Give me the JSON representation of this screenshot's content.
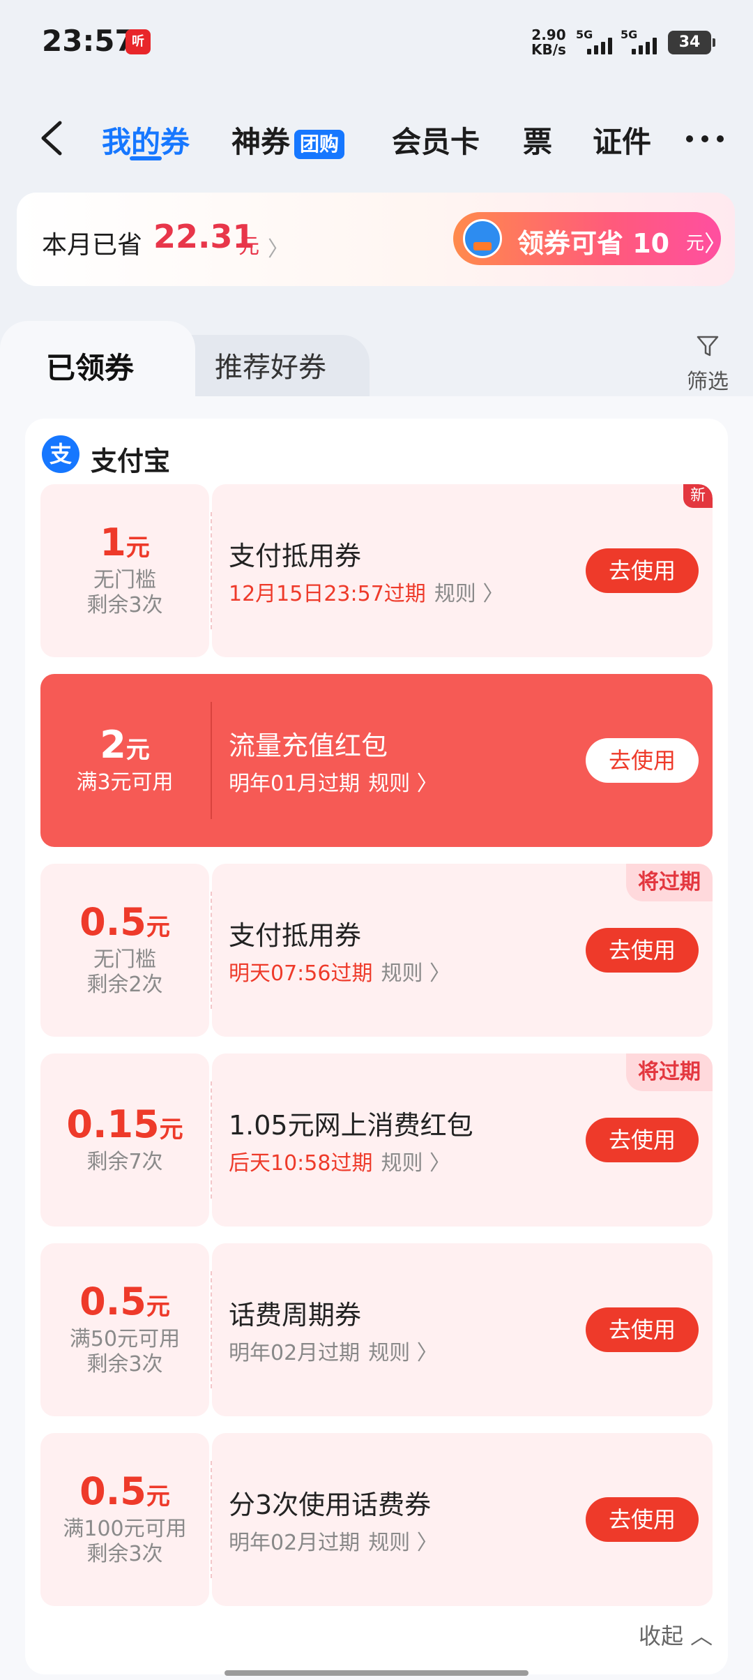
{
  "status_bar": {
    "time": "23:57",
    "app_icon_text": "听",
    "net_speed_value": "2.90",
    "net_speed_unit": "KB/s",
    "sim1_label": "5G",
    "sim2_label": "5G",
    "battery": "34"
  },
  "nav": {
    "tabs": [
      {
        "label": "我的券",
        "active": true
      },
      {
        "label": "神券",
        "badge": "团购"
      },
      {
        "label": "会员卡"
      },
      {
        "label": "票"
      },
      {
        "label": "证件"
      }
    ],
    "more_icon": "more-dots-icon",
    "back_icon": "chevron-left-icon"
  },
  "savings": {
    "label": "本月已省",
    "amount": "22.31",
    "unit": "元",
    "pill_text": "领券可省 10",
    "pill_unit": "元"
  },
  "list_tabs": {
    "claimed": "已领券",
    "recommended": "推荐好券",
    "filter": "筛选"
  },
  "provider": {
    "logo_text": "支",
    "name": "支付宝"
  },
  "coupons": [
    {
      "amount": "1",
      "unit": "元",
      "cond1": "无门槛",
      "cond2": "剩余3次",
      "title": "支付抵用券",
      "expiry": "12月15日23:57过期",
      "rules": "规则 〉",
      "button": "去使用",
      "tag": "新"
    },
    {
      "amount": "2",
      "unit": "元",
      "cond1": "满3元可用",
      "cond2": "",
      "title": "流量充值红包",
      "expiry": "明年01月过期",
      "rules": "规则 〉",
      "button": "去使用",
      "tag": ""
    },
    {
      "amount": "0.5",
      "unit": "元",
      "cond1": "无门槛",
      "cond2": "剩余2次",
      "title": "支付抵用券",
      "expiry": "明天07:56过期",
      "rules": "规则 〉",
      "button": "去使用",
      "tag": "将过期"
    },
    {
      "amount": "0.15",
      "unit": "元",
      "cond1": "剩余7次",
      "cond2": "",
      "title": "1.05元网上消费红包",
      "expiry": "后天10:58过期",
      "rules": "规则 〉",
      "button": "去使用",
      "tag": "将过期"
    },
    {
      "amount": "0.5",
      "unit": "元",
      "cond1": "满50元可用",
      "cond2": "剩余3次",
      "title": "话费周期券",
      "expiry": "明年02月过期",
      "rules": "规则 〉",
      "button": "去使用",
      "tag": ""
    },
    {
      "amount": "0.5",
      "unit": "元",
      "cond1": "满100元可用",
      "cond2": "剩余3次",
      "title": "分3次使用话费券",
      "expiry": "明年02月过期",
      "rules": "规则 〉",
      "button": "去使用",
      "tag": ""
    }
  ],
  "collapse_label": "收起 ︿",
  "colors": {
    "accent_blue": "#1677ff",
    "coupon_red": "#ee3a2a",
    "coupon_bg": "#fff0f1",
    "highlight_bg": "#f65a55"
  }
}
